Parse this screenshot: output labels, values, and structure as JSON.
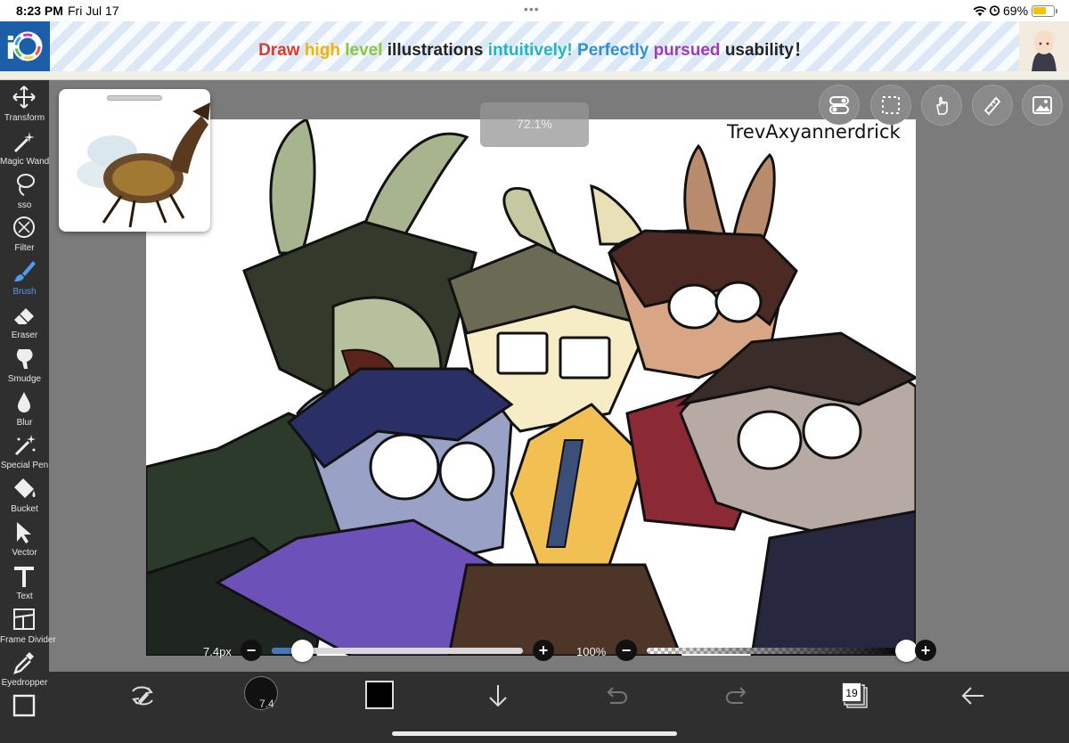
{
  "status_bar": {
    "time": "8:23 PM",
    "date": "Fri Jul 17",
    "dots": "•••",
    "battery_percent": "69%",
    "battery_level": 0.69
  },
  "ad": {
    "segments": [
      {
        "text": "Draw ",
        "color": "#e03a2a"
      },
      {
        "text": "high ",
        "color": "#f1b400"
      },
      {
        "text": "level ",
        "color": "#8cc63e"
      },
      {
        "text": "illustrations ",
        "color": "#222222"
      },
      {
        "text": "intuitively! ",
        "color": "#25b5c2"
      },
      {
        "text": "Perfectly ",
        "color": "#2f8fd8"
      },
      {
        "text": "pursued ",
        "color": "#9b3fb3"
      },
      {
        "text": "usability",
        "color": "#222222"
      },
      {
        "text": "！",
        "color": "#222222"
      }
    ]
  },
  "tools": [
    {
      "name": "Transform",
      "icon": "move-arrows-icon"
    },
    {
      "name": "Magic Wand",
      "icon": "magic-wand-icon"
    },
    {
      "name": "sso",
      "icon": "lasso-icon"
    },
    {
      "name": "Filter",
      "icon": "filter-fx-icon"
    },
    {
      "name": "Brush",
      "icon": "brush-icon",
      "active": true
    },
    {
      "name": "Eraser",
      "icon": "eraser-icon"
    },
    {
      "name": "Smudge",
      "icon": "smudge-icon"
    },
    {
      "name": "Blur",
      "icon": "blur-drop-icon"
    },
    {
      "name": "Special Pen",
      "icon": "special-pen-icon"
    },
    {
      "name": "Bucket",
      "icon": "bucket-icon"
    },
    {
      "name": "Vector",
      "icon": "vector-cursor-icon"
    },
    {
      "name": "Text",
      "icon": "text-t-icon"
    },
    {
      "name": "Frame Divider",
      "icon": "frame-divider-icon"
    },
    {
      "name": "Eyedropper",
      "icon": "eyedropper-icon"
    },
    {
      "name": "",
      "icon": "canvas-icon"
    }
  ],
  "canvas": {
    "zoom": "72.1%",
    "watermark": "TrevAxyannerdrick"
  },
  "sliders": {
    "brush_size_label": "7.4px",
    "brush_size_level": 0.12,
    "opacity_label": "100%",
    "opacity_level": 1.0
  },
  "top_buttons": [
    "toggle-settings-icon",
    "selection-icon",
    "touch-gesture-icon",
    "ruler-icon",
    "material-image-icon"
  ],
  "bottom_bar": {
    "brush_size": "7.4",
    "color": "#000000",
    "layer_count": "19",
    "icons": [
      "swap-icon",
      "brush-size-icon",
      "color-swatch",
      "download-arrow-icon",
      "undo-icon",
      "redo-icon",
      "layers-icon",
      "back-arrow-icon"
    ]
  }
}
